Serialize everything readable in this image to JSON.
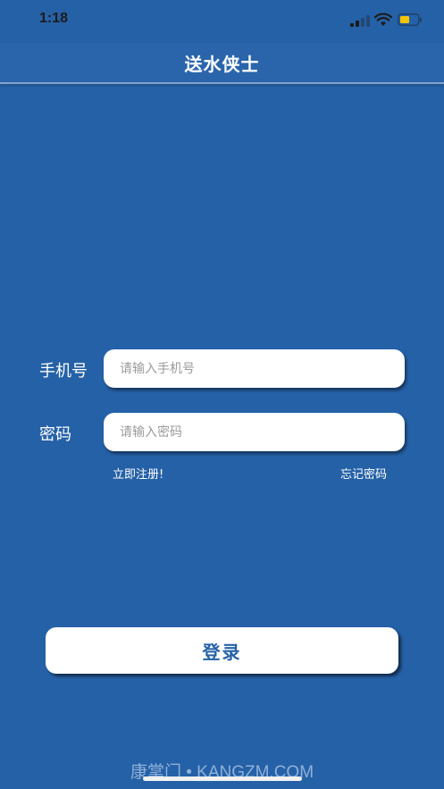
{
  "status_bar": {
    "time": "1:18"
  },
  "nav": {
    "title": "送水侠士"
  },
  "form": {
    "phone_label": "手机号",
    "phone_placeholder": "请输入手机号",
    "phone_value": "",
    "password_label": "密码",
    "password_placeholder": "请输入密码",
    "password_value": ""
  },
  "links": {
    "register": "立即注册!",
    "forgot_password": "忘记密码"
  },
  "login_button": {
    "label": "登录"
  },
  "watermark": {
    "text": "康掌门 • KANGZM.COM"
  },
  "colors": {
    "background": "#2561a7",
    "nav_background": "#2a65ac",
    "button_text": "#2561a7",
    "battery_fill": "#f5c400"
  }
}
